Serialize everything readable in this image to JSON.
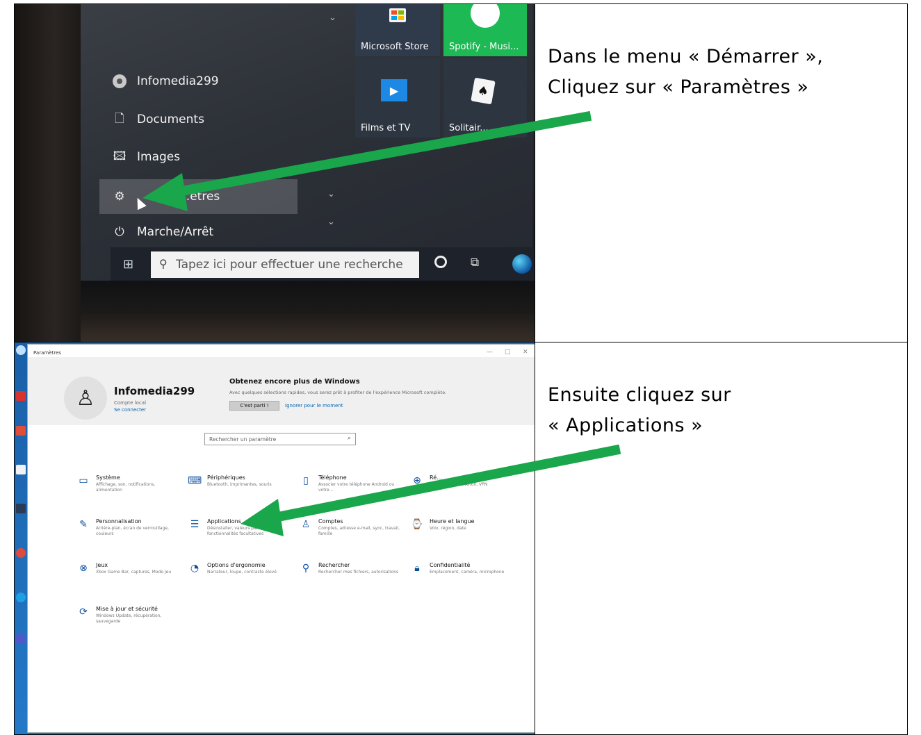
{
  "instructions": {
    "step1_line1": "Dans le menu « Démarrer »,",
    "step1_line2": "Cliquez sur « Paramètres »",
    "step2_line1": "Ensuite cliquez sur",
    "step2_line2": "« Applications »"
  },
  "start_menu": {
    "user": "Infomedia299",
    "items": [
      {
        "label": "Documents",
        "icon": "document-icon"
      },
      {
        "label": "Images",
        "icon": "image-icon"
      },
      {
        "label": "Paramètres",
        "icon": "gear-icon"
      },
      {
        "label": "Marche/Arrêt",
        "icon": "power-icon"
      }
    ],
    "settings_visible_label": "...ètres",
    "tiles": {
      "store": "Microsoft Store",
      "spotify": "Spotify - Musi...",
      "films": "Films et TV",
      "solitaire": "Solitair..."
    },
    "search_placeholder": "Tapez ici pour effectuer une recherche"
  },
  "settings": {
    "window_title": "Paramètres",
    "account_name": "Infomedia299",
    "account_type": "Compte local",
    "account_link": "Se connecter",
    "promo_title": "Obtenez encore plus de Windows",
    "promo_sub": "Avec quelques sélections rapides, vous serez prêt à profiter de l'expérience Microsoft complète.",
    "promo_button": "C'est parti !",
    "promo_link": "Ignorer pour le moment",
    "search_placeholder": "Rechercher un paramètre",
    "categories": [
      {
        "title": "Système",
        "desc": "Affichage, son, notifications, alimentation",
        "icon": "laptop-icon"
      },
      {
        "title": "Périphériques",
        "desc": "Bluetooth, imprimantes, souris",
        "icon": "keyboard-icon"
      },
      {
        "title": "Téléphone",
        "desc": "Associer votre téléphone Android ou votre...",
        "icon": "phone-icon"
      },
      {
        "title": "Ré...",
        "desc": "...ode Avion, VPN",
        "icon": "globe-icon"
      },
      {
        "title": "Personnalisation",
        "desc": "Arrière-plan, écran de verrouillage, couleurs",
        "icon": "brush-icon"
      },
      {
        "title": "Applications",
        "desc": "Désinstaller, valeurs par défaut, fonctionnalités facultatives",
        "icon": "apps-list-icon"
      },
      {
        "title": "Comptes",
        "desc": "Comptes, adresse e-mail, sync, travail, famille",
        "icon": "person-icon"
      },
      {
        "title": "Heure et langue",
        "desc": "Voix, région, date",
        "icon": "language-icon"
      },
      {
        "title": "Jeux",
        "desc": "Xbox Game Bar, captures, Mode Jeu",
        "icon": "xbox-icon"
      },
      {
        "title": "Options d'ergonomie",
        "desc": "Narrateur, loupe, contraste élevé",
        "icon": "ease-of-access-icon"
      },
      {
        "title": "Rechercher",
        "desc": "Rechercher mes fichiers, autorisations",
        "icon": "search-icon"
      },
      {
        "title": "Confidentialité",
        "desc": "Emplacement, caméra, microphone",
        "icon": "lock-icon"
      },
      {
        "title": "Mise à jour et sécurité",
        "desc": "Windows Update, récupération, sauvegarde",
        "icon": "update-icon"
      }
    ]
  },
  "colors": {
    "arrow": "#1aa64b",
    "accent": "#0063b1",
    "spotify": "#1db954"
  }
}
